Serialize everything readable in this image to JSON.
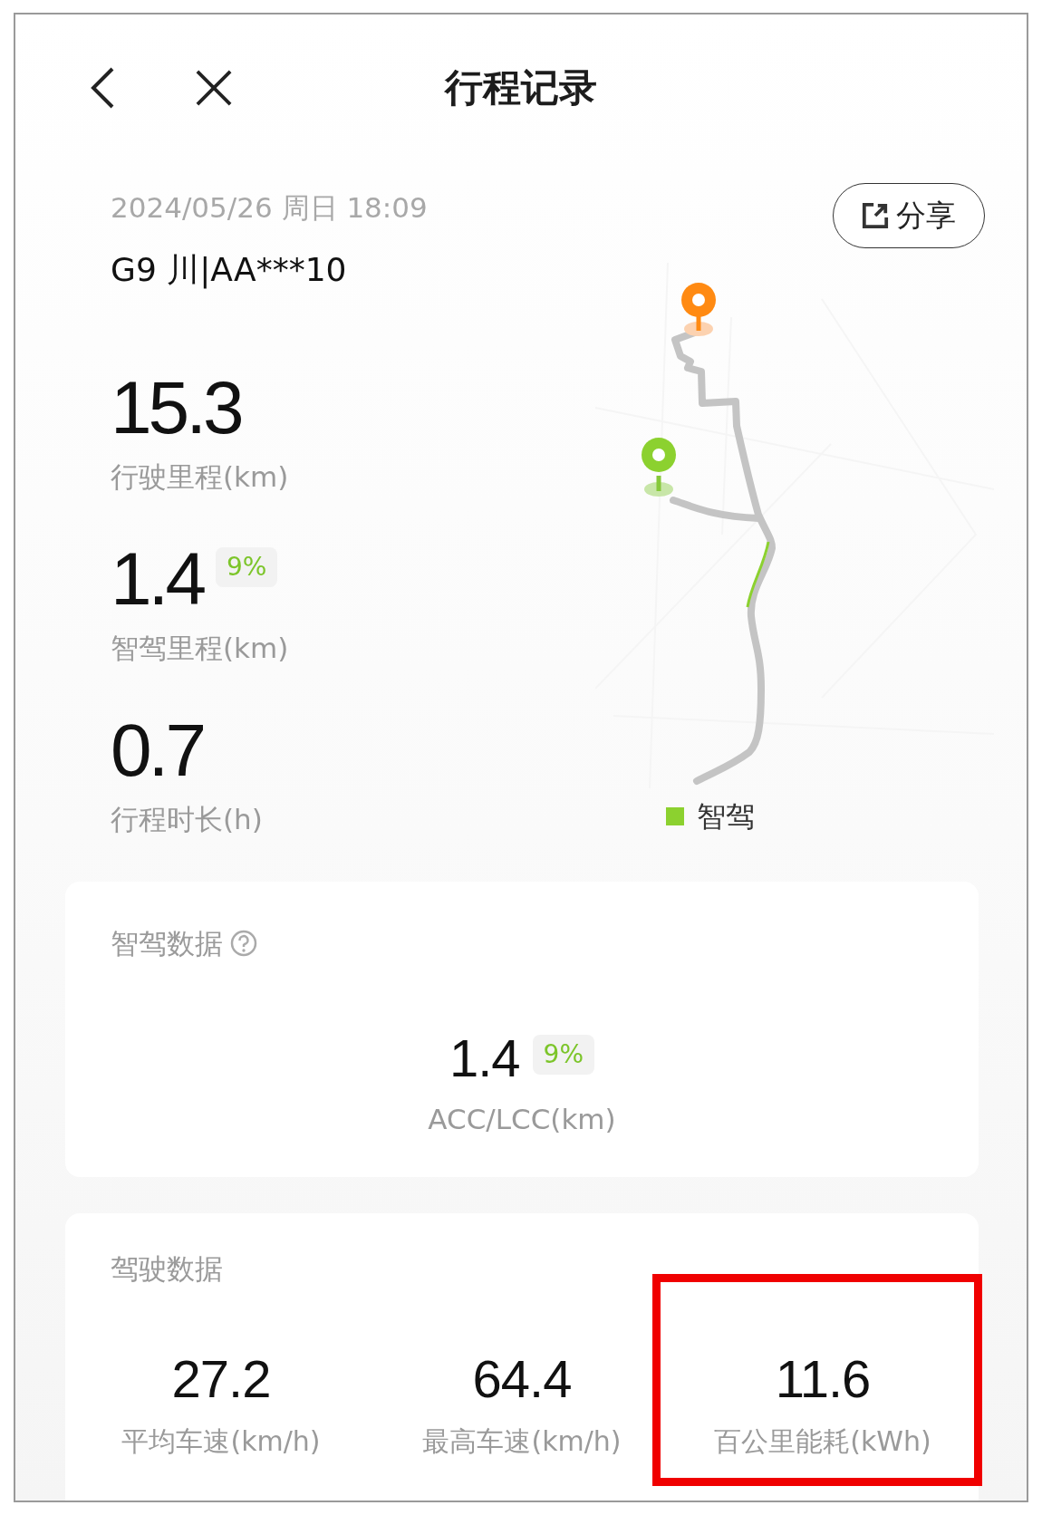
{
  "header": {
    "title": "行程记录"
  },
  "trip": {
    "datetime": "2024/05/26 周日 18:09",
    "vehicle": "G9 川|AA***10"
  },
  "share": {
    "label": "分享"
  },
  "stats": [
    {
      "value": "15.3",
      "label": "行驶里程(km)"
    },
    {
      "value": "1.4",
      "badge": "9%",
      "label": "智驾里程(km)"
    },
    {
      "value": "0.7",
      "label": "行程时长(h)"
    }
  ],
  "map": {
    "legend": [
      {
        "label": "智驾",
        "color": "#8cd12f"
      }
    ]
  },
  "smart_drive": {
    "title": "智驾数据",
    "stats": [
      {
        "value": "1.4",
        "badge": "9%",
        "label": "ACC/LCC(km)"
      }
    ]
  },
  "driving": {
    "title": "驾驶数据",
    "stats": [
      {
        "value": "27.2",
        "label": "平均车速(km/h)",
        "highlighted": false
      },
      {
        "value": "64.4",
        "label": "最高车速(km/h)",
        "highlighted": false
      },
      {
        "value": "11.6",
        "label": "百公里能耗(kWh)",
        "highlighted": true
      }
    ]
  }
}
